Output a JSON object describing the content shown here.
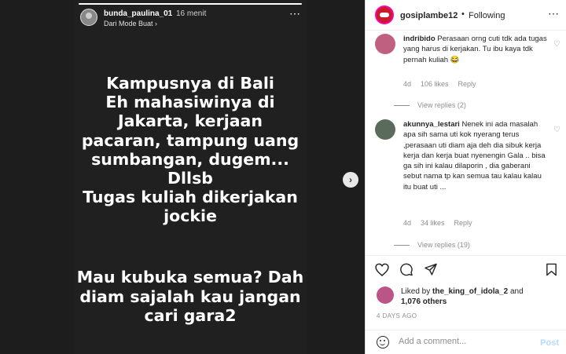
{
  "story": {
    "username": "bunda_paulina_01",
    "time": "16 menit",
    "subtitle": "Dari Mode Buat",
    "subtitle_chevron": "›",
    "more": "⋯",
    "text_block1": "Kampusnya di Bali\nEh mahasiwinya di\nJakarta, kerjaan\npacaran, tampung uang\nsumbangan, dugem...\nDllsb\nTugas kuliah dikerjakan\njockie",
    "text_block2": "Mau kubuka semua? Dah\ndiam sajalah kau jangan\ncari gara2",
    "progress": 1.0,
    "next": "›"
  },
  "post": {
    "username": "gosiplambe12",
    "dot": "•",
    "follow": "Following",
    "more": "⋯"
  },
  "comments": [
    {
      "user": "indribido",
      "text": "Perasaan orng cuti tdk ada tugas yang harus di kerjakan. Tu ibu kaya tdk pernah kuliah 😂",
      "age": "4d",
      "likes": "106 likes",
      "reply": "Reply",
      "view_replies": "View replies (2)"
    },
    {
      "user": "akunnya_lestari",
      "text": "Nenek ini ada masalah apa sih sama uti kok nyerang terus ,perasaan uti diam aja deh dia sibuk kerja kerja dan kerja buat nyenengin Gala .. bisa ga sih ini kalau dilaporin , dia gaberani sebut nama tp kan semua tau kalau kalau itu buat uti ...",
      "age": "4d",
      "likes": "34 likes",
      "reply": "Reply",
      "view_replies": "View replies (19)"
    }
  ],
  "actions": {
    "like": "♡",
    "comment": "◯",
    "share": "➤",
    "save": "▯"
  },
  "likes": {
    "prefix": "Liked by",
    "user": "the_king_of_idola_2",
    "and": "and",
    "others": "1,076 others"
  },
  "date": "4 DAYS AGO",
  "add_comment": {
    "placeholder": "Add a comment...",
    "post": "Post"
  }
}
